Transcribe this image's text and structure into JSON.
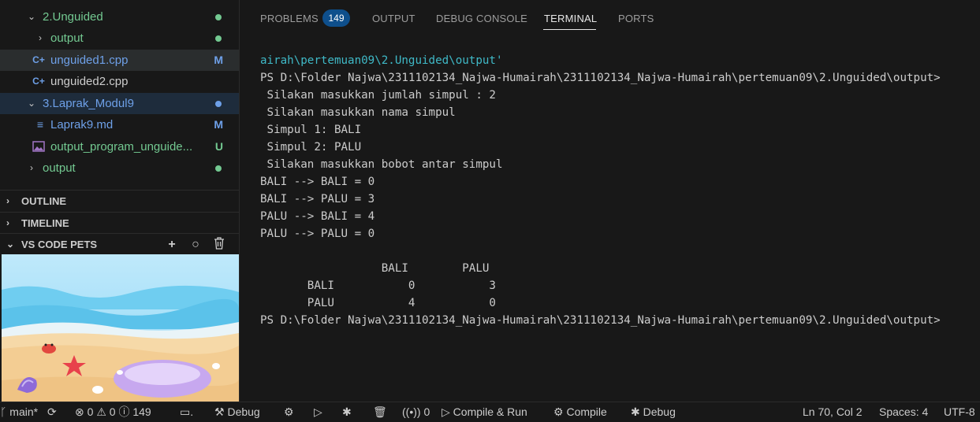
{
  "explorer": {
    "rows": [
      {
        "label": "2.Unguided",
        "type": "folder-open",
        "color": "#73c991",
        "badge": "dot",
        "badge_color": "#73c991"
      },
      {
        "label": "output",
        "type": "folder",
        "color": "#73c991",
        "badge": "dot",
        "badge_color": "#73c991"
      },
      {
        "label": "unguided1.cpp",
        "type": "cpp",
        "color": "#6ea0e8",
        "badge": "M",
        "badge_color": "#6ea0e8"
      },
      {
        "label": "unguided2.cpp",
        "type": "cpp",
        "color": "#cccccc",
        "badge": "",
        "badge_color": ""
      },
      {
        "label": "3.Laprak_Modul9",
        "type": "folder-open",
        "color": "#6ea0e8",
        "badge": "dot",
        "badge_color": "#6ea0e8"
      },
      {
        "label": "Laprak9.md",
        "type": "md",
        "color": "#6ea0e8",
        "badge": "M",
        "badge_color": "#6ea0e8"
      },
      {
        "label": "output_program_unguide...",
        "type": "image",
        "color": "#73c991",
        "badge": "U",
        "badge_color": "#73c991"
      },
      {
        "label": "output",
        "type": "folder",
        "color": "#73c991",
        "badge": "dot",
        "badge_color": "#73c991"
      }
    ]
  },
  "sections": {
    "outline": "OUTLINE",
    "timeline": "TIMELINE",
    "pets": "VS CODE PETS"
  },
  "panel": {
    "tabs": {
      "problems": "PROBLEMS",
      "problems_count": "149",
      "output": "OUTPUT",
      "debug_console": "DEBUG CONSOLE",
      "terminal": "TERMINAL",
      "ports": "PORTS"
    }
  },
  "terminal": {
    "path_line": "airah\\pertemuan09\\2.Unguided\\output'",
    "lines": [
      "PS D:\\Folder Najwa\\2311102134_Najwa-Humairah\\2311102134_Najwa-Humairah\\pertemuan09\\2.Unguided\\output> ",
      " Silakan masukkan jumlah simpul : 2",
      " Silakan masukkan nama simpul",
      " Simpul 1: BALI",
      " Simpul 2: PALU",
      " Silakan masukkan bobot antar simpul",
      "BALI --> BALI = 0",
      "BALI --> PALU = 3",
      "PALU --> BALI = 4",
      "PALU --> PALU = 0",
      "",
      "                  BALI        PALU",
      "       BALI           0           3",
      "       PALU           4           0",
      "PS D:\\Folder Najwa\\2311102134_Najwa-Humairah\\2311102134_Najwa-Humairah\\pertemuan09\\2.Unguided\\output> "
    ]
  },
  "statusbar": {
    "branch": "main*",
    "errors": "0",
    "warnings": "0",
    "infos": "149",
    "debug": "Debug",
    "ports": "0",
    "compile_run": "Compile & Run",
    "compile": "Compile",
    "debug2": "Debug",
    "position": "Ln 70, Col 2",
    "spaces": "Spaces: 4",
    "encoding": "UTF-8"
  },
  "colors": {
    "accent_blue": "#0e4f8c",
    "git_added": "#73c991",
    "git_modified": "#6ea0e8",
    "terminal_path": "#3fb9c7"
  }
}
